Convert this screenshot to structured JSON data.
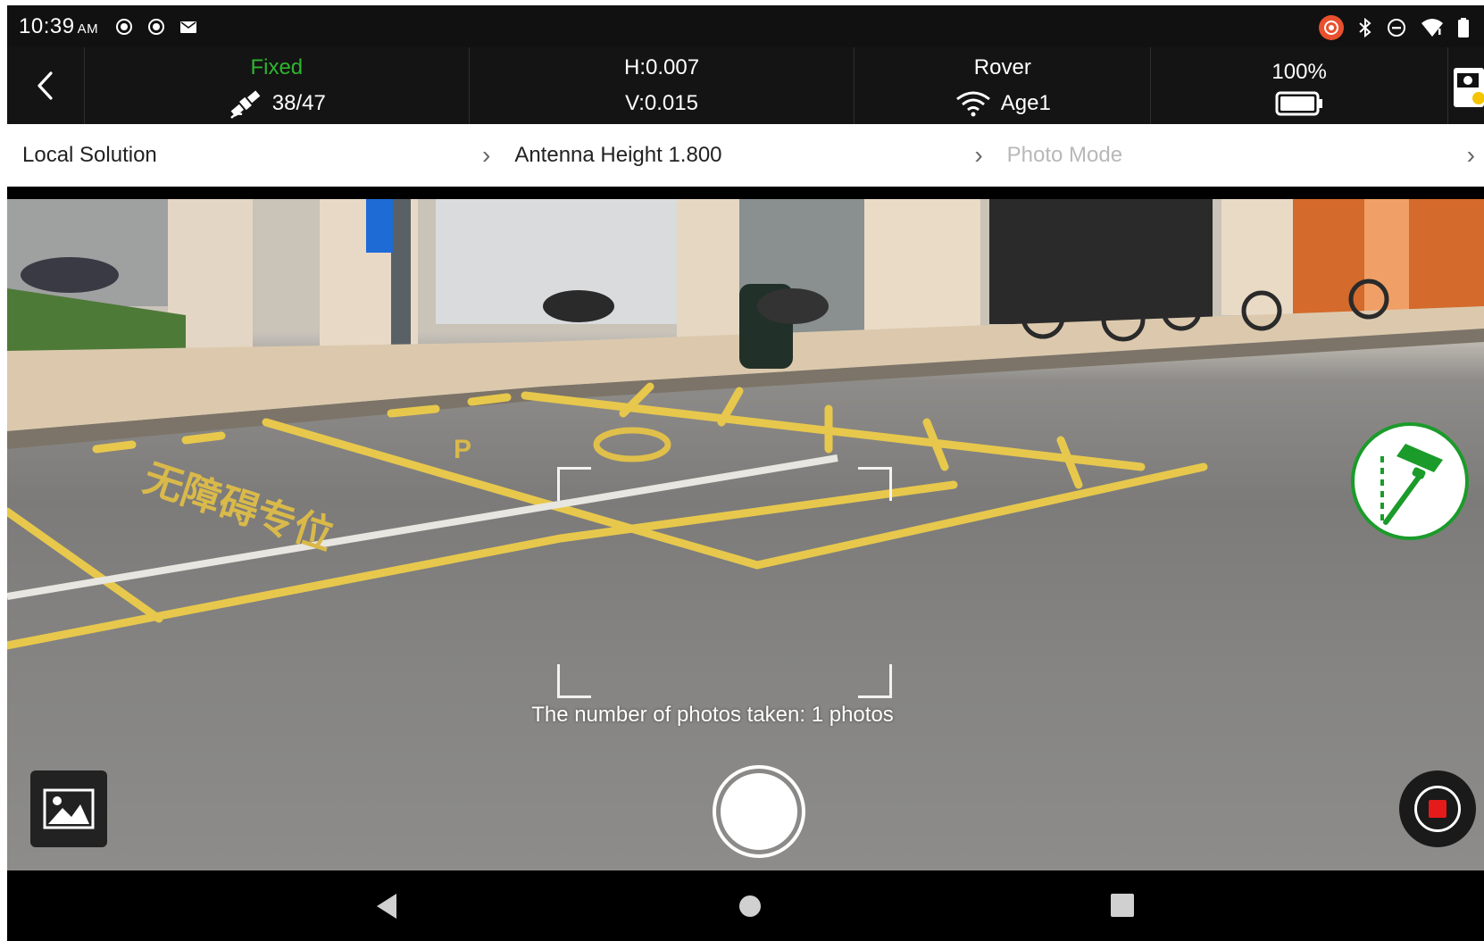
{
  "status_bar": {
    "time": "10:39",
    "ampm": "AM",
    "left_icons": [
      "screen-record-icon",
      "screen-record-icon",
      "mail-icon"
    ],
    "right_icons": [
      "record-indicator-icon",
      "bluetooth-icon",
      "do-not-disturb-icon",
      "wifi-signal-icon",
      "battery-icon"
    ]
  },
  "rtk_bar": {
    "back_icon": "back-arrow-icon",
    "solution_status": "Fixed",
    "satellites": "38/47",
    "h_precision": "H:0.007",
    "v_precision": "V:0.015",
    "mode": "Rover",
    "age": "Age1",
    "battery_percent": "100%",
    "battery_level": 1.0,
    "device_icon": "instrument-icon"
  },
  "options": {
    "local_solution": "Local Solution",
    "antenna_height": "Antenna Height 1.800",
    "photo_mode": "Photo Mode"
  },
  "camera": {
    "photos_taken_text": "The number of photos taken: 1 photos"
  },
  "colors": {
    "fixed_green": "#2fb52f",
    "survey_green": "#1b9b2a",
    "record_red": "#e51b1b"
  },
  "nav": {
    "back": "nav-back-icon",
    "home": "nav-home-icon",
    "recents": "nav-recents-icon"
  }
}
